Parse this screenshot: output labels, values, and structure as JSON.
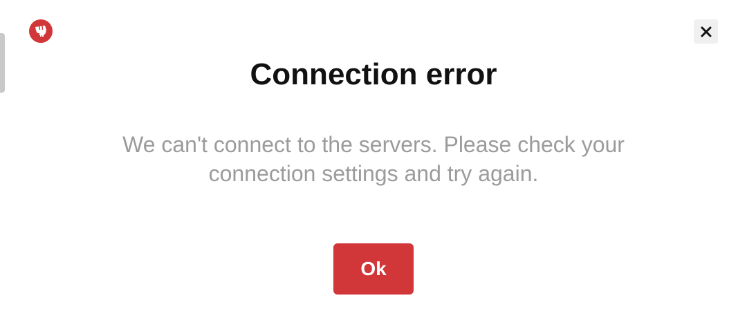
{
  "dialog": {
    "title": "Connection error",
    "message": "We can't connect to the servers. Please check your connection settings and try again.",
    "ok_label": "Ok"
  },
  "icons": {
    "logo": "riot-fist-logo-icon",
    "close": "close-icon"
  },
  "colors": {
    "accent": "#d13639",
    "title": "#111111",
    "message": "#9b9b9b",
    "close_bg": "#f0f0f0"
  }
}
